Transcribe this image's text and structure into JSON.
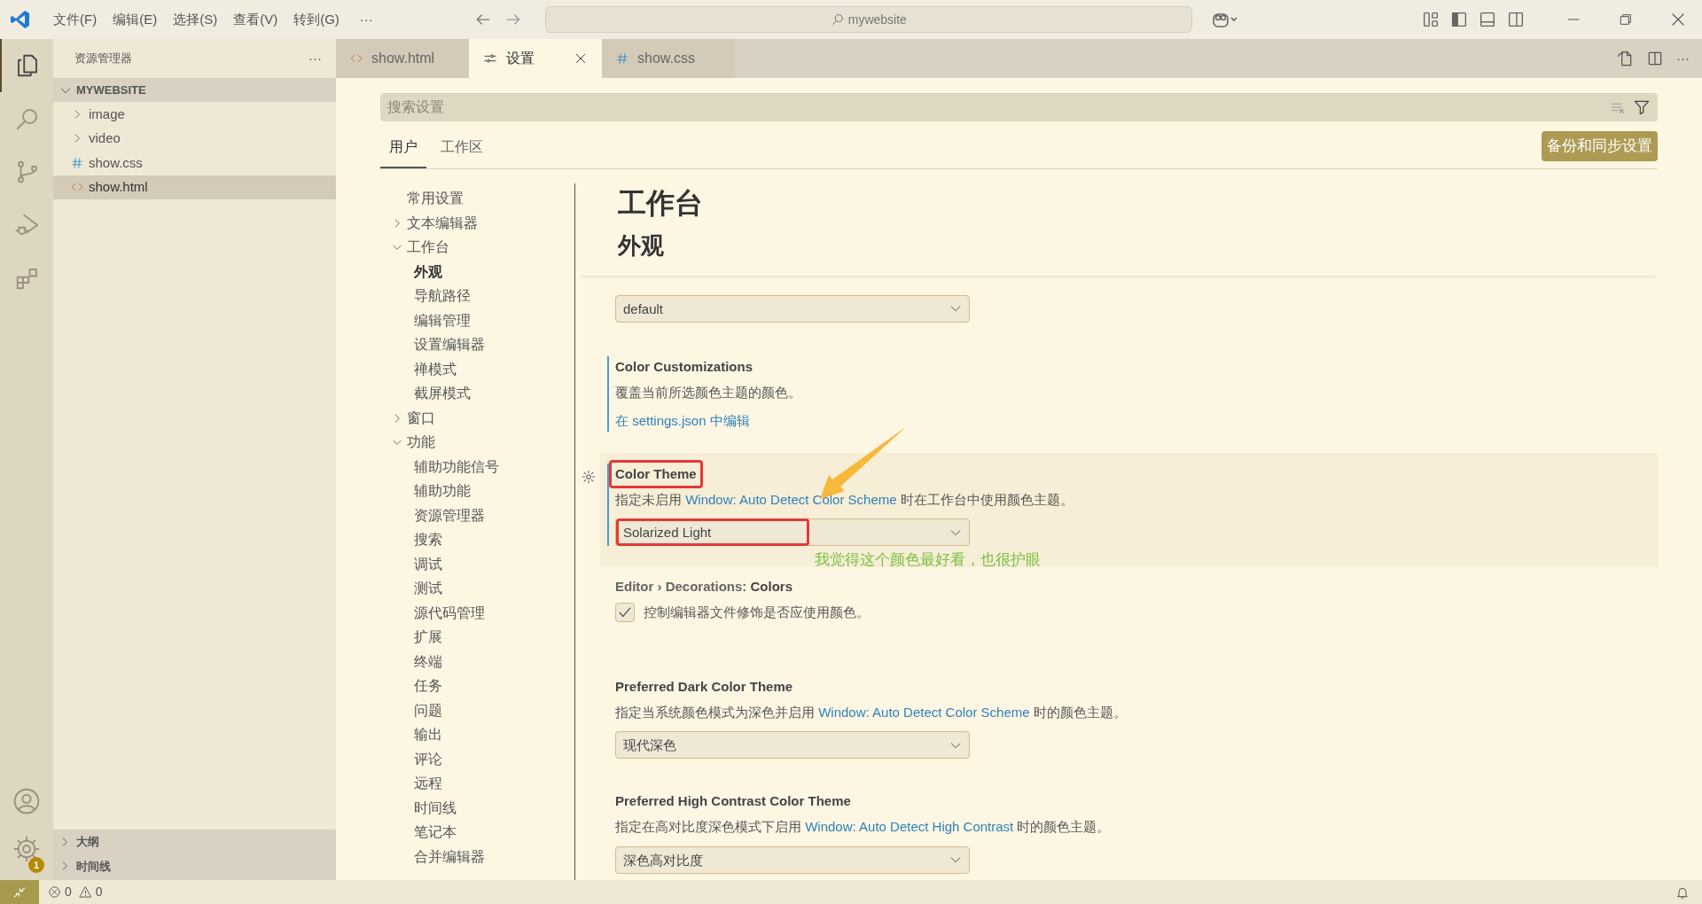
{
  "title_bar": {
    "menus": [
      "文件(F)",
      "编辑(E)",
      "选择(S)",
      "查看(V)",
      "转到(G)"
    ],
    "more": "···",
    "command_center": "mywebsite"
  },
  "activity_bar": {
    "items": [
      {
        "kind": "files",
        "selected": true
      },
      {
        "kind": "search",
        "selected": false
      },
      {
        "kind": "source-control",
        "selected": false
      },
      {
        "kind": "run",
        "selected": false
      },
      {
        "kind": "extensions",
        "selected": false
      }
    ],
    "settings_badge": "1"
  },
  "sidebar": {
    "title": "资源管理器",
    "more": "···",
    "folder": {
      "label": "MYWEBSITE",
      "expanded": true,
      "children": [
        {
          "label": "image",
          "kind": "folder",
          "selected": false
        },
        {
          "label": "video",
          "kind": "folder",
          "selected": false
        },
        {
          "label": "show.css",
          "kind": "css",
          "selected": false
        },
        {
          "label": "show.html",
          "kind": "html",
          "selected": true
        }
      ]
    },
    "panels": [
      "大纲",
      "时间线"
    ]
  },
  "tabs": [
    {
      "label": "show.html",
      "kind": "html",
      "selected": false
    },
    {
      "label": "设置",
      "kind": "settings",
      "selected": true
    },
    {
      "label": "show.css",
      "kind": "css",
      "selected": false
    }
  ],
  "settings": {
    "search_placeholder": "搜索设置",
    "scope_tabs": [
      {
        "label": "用户",
        "selected": true
      },
      {
        "label": "工作区",
        "selected": false
      }
    ],
    "sync_button": "备份和同步设置",
    "toc": [
      {
        "label": "常用设置",
        "selected": false
      },
      {
        "label": "文本编辑器",
        "selected": false,
        "expanded": false
      },
      {
        "label": "工作台",
        "selected": false,
        "expanded": true,
        "children": [
          {
            "label": "外观",
            "selected": true
          },
          {
            "label": "导航路径",
            "selected": false
          },
          {
            "label": "编辑管理",
            "selected": false
          },
          {
            "label": "设置编辑器",
            "selected": false
          },
          {
            "label": "禅模式",
            "selected": false
          },
          {
            "label": "截屏模式",
            "selected": false
          }
        ]
      },
      {
        "label": "窗口",
        "selected": false,
        "expanded": false
      },
      {
        "label": "功能",
        "selected": false,
        "expanded": true,
        "children": [
          {
            "label": "辅助功能信号",
            "selected": false
          },
          {
            "label": "辅助功能",
            "selected": false
          },
          {
            "label": "资源管理器",
            "selected": false
          },
          {
            "label": "搜索",
            "selected": false
          },
          {
            "label": "调试",
            "selected": false
          },
          {
            "label": "测试",
            "selected": false
          },
          {
            "label": "源代码管理",
            "selected": false
          },
          {
            "label": "扩展",
            "selected": false
          },
          {
            "label": "终端",
            "selected": false
          },
          {
            "label": "任务",
            "selected": false
          },
          {
            "label": "问题",
            "selected": false
          },
          {
            "label": "输出",
            "selected": false
          },
          {
            "label": "评论",
            "selected": false
          },
          {
            "label": "远程",
            "selected": false
          },
          {
            "label": "时间线",
            "selected": false
          },
          {
            "label": "笔记本",
            "selected": false
          },
          {
            "label": "合并编辑器",
            "selected": false
          }
        ]
      }
    ],
    "heading": "工作台",
    "subheading": "外观",
    "entries": [
      {
        "kind": "dropdown",
        "value": "default",
        "modified": false,
        "focused": false,
        "annotated": false
      },
      {
        "kind": "link",
        "title": "Color Customizations",
        "description": {
          "before": "覆盖当前所选颜色主题的颜色。"
        },
        "link": "在 settings.json 中编辑",
        "modified": true,
        "focused": false,
        "annotated": false
      },
      {
        "kind": "dropdown",
        "title": "Color Theme",
        "description": {
          "before": "指定未启用 ",
          "link": "Window: Auto Detect Color Scheme",
          "after": " 时在工作台中使用颜色主题。"
        },
        "value": "Solarized Light",
        "modified": true,
        "focused": true,
        "annotated": true
      },
      {
        "kind": "checkbox",
        "category": "Editor › Decorations: ",
        "title": "Colors",
        "description": {
          "before": "控制编辑器文件修饰是否应使用颜色。"
        },
        "checked": true,
        "modified": false,
        "focused": false,
        "annotated": false
      },
      {
        "kind": "dropdown",
        "title": "Preferred Dark Color Theme",
        "description": {
          "before": "指定当系统颜色模式为深色并启用 ",
          "link": "Window: Auto Detect Color Scheme",
          "after": " 时的颜色主题。"
        },
        "value": "现代深色",
        "modified": false,
        "focused": false,
        "annotated": false
      },
      {
        "kind": "dropdown",
        "title": "Preferred High Contrast Color Theme",
        "description": {
          "before": "指定在高对比度深色模式下启用 ",
          "link": "Window: Auto Detect High Contrast",
          "after": " 时的颜色主题。"
        },
        "value": "深色高对比度",
        "modified": false,
        "focused": false,
        "annotated": false
      }
    ]
  },
  "annotation": {
    "note": "我觉得这个颜色最好看，也很护眼"
  },
  "status_bar": {
    "errors": "0",
    "warnings": "0"
  }
}
